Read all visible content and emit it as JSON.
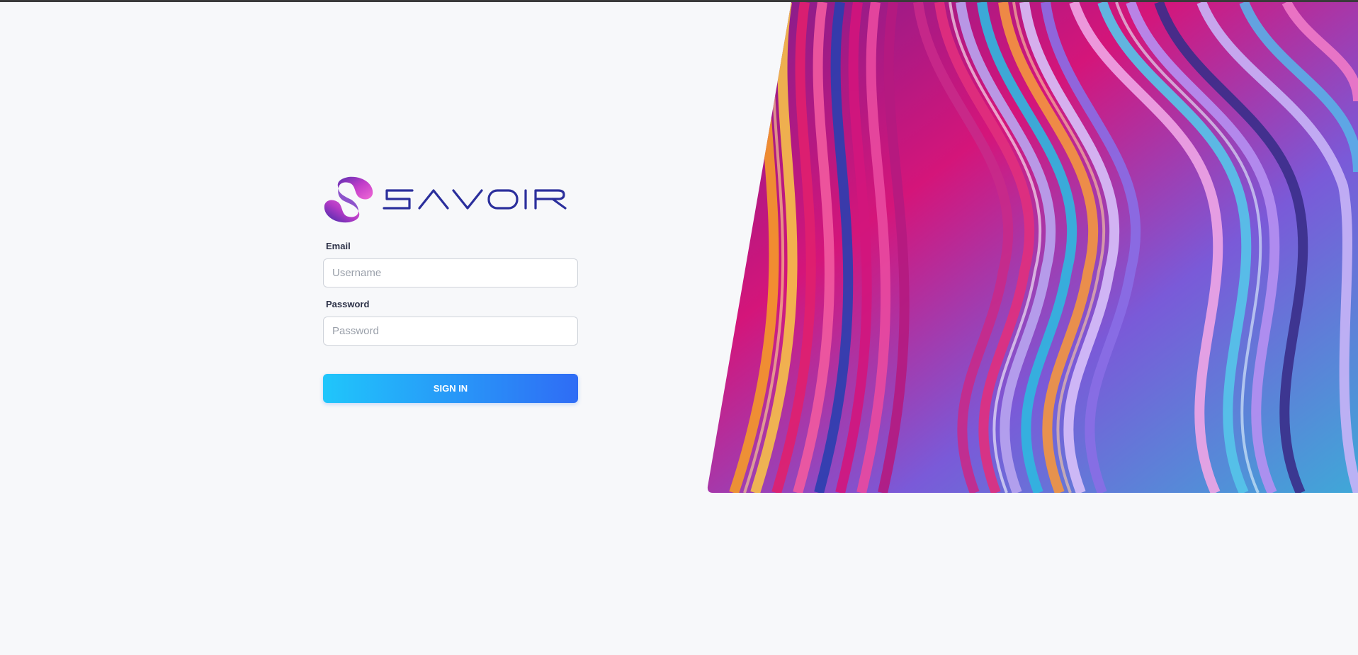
{
  "brand": {
    "name": "SAVOIR",
    "logo_icon": "savoir-swirl-logo",
    "wordmark_color": "#2b2f9c"
  },
  "form": {
    "email_label": "Email",
    "email_placeholder": "Username",
    "email_value": "",
    "password_label": "Password",
    "password_placeholder": "Password",
    "password_value": "",
    "signin_label": "SIGN IN"
  },
  "colors": {
    "page_bg": "#f7f8fa",
    "button_gradient_start": "#20c6fb",
    "button_gradient_end": "#2f6cf5",
    "label_color": "#2c3147"
  },
  "decor": {
    "background_art": "abstract-colorful-waves-image"
  }
}
